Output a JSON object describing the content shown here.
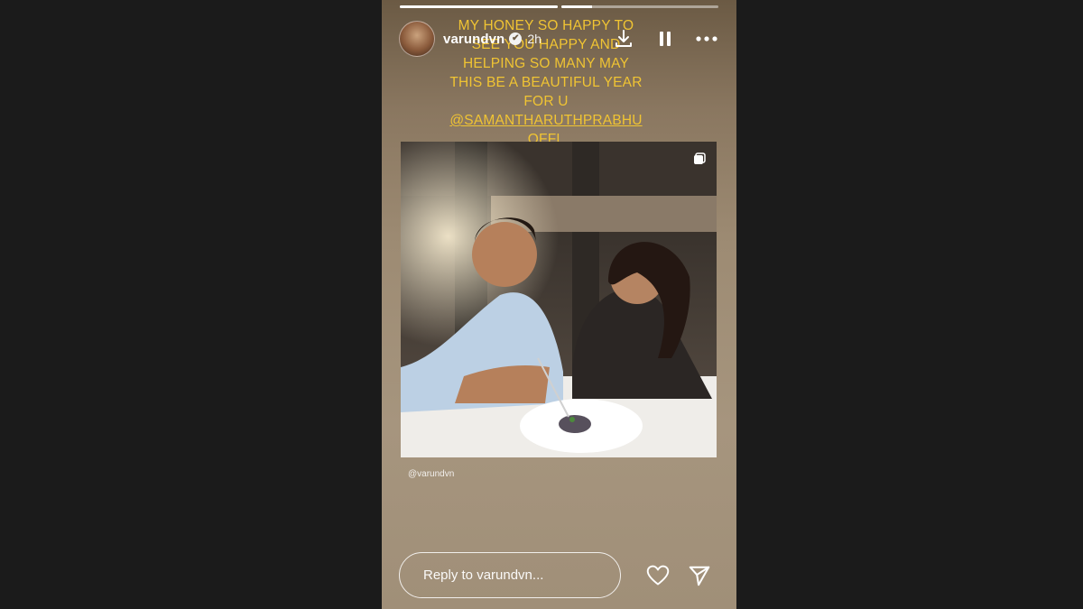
{
  "story": {
    "progress": [
      {
        "fill": 1.0
      },
      {
        "fill": 0.2
      }
    ],
    "header": {
      "username": "varundvn",
      "verified_glyph": "✔",
      "time_ago": "2h",
      "icons": [
        "download-icon",
        "pause-icon",
        "more-icon"
      ]
    },
    "caption": {
      "lines": [
        "MY HONEY SO HAPPY TO",
        "SEE YOU HAPPY AND",
        "HELPING SO MANY MAY",
        "THIS BE A BEAUTIFUL YEAR",
        "FOR U"
      ],
      "mention_lines": [
        "@SAMANTHARUTHPRABHU",
        "OFFL"
      ],
      "color": "#f0c433"
    },
    "photo_credit": "@varundvn",
    "reply": {
      "placeholder": "Reply to varundvn..."
    },
    "footer_icons": [
      "heart-icon",
      "send-icon"
    ]
  }
}
